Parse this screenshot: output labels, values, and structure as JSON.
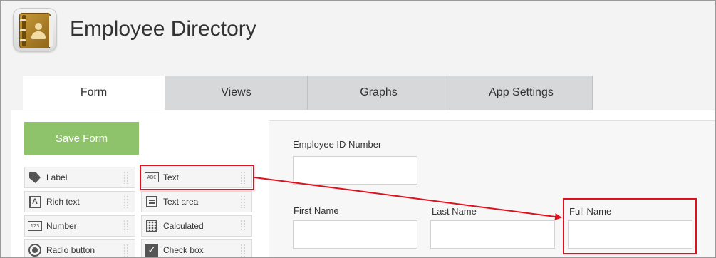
{
  "app": {
    "title": "Employee Directory",
    "icon": "address-book-icon"
  },
  "tabs": [
    {
      "label": "Form",
      "active": true
    },
    {
      "label": "Views",
      "active": false
    },
    {
      "label": "Graphs",
      "active": false
    },
    {
      "label": "App Settings",
      "active": false
    }
  ],
  "toolbar": {
    "save_label": "Save Form"
  },
  "palette": [
    {
      "label": "Label",
      "icon": "tag-icon"
    },
    {
      "label": "Text",
      "icon": "text-field-icon",
      "icon_text": "ABC"
    },
    {
      "label": "Rich text",
      "icon": "rich-text-icon",
      "icon_text": "A"
    },
    {
      "label": "Text area",
      "icon": "text-area-icon"
    },
    {
      "label": "Number",
      "icon": "number-icon",
      "icon_text": "123"
    },
    {
      "label": "Calculated",
      "icon": "calculator-icon"
    },
    {
      "label": "Radio button",
      "icon": "radio-button-icon"
    },
    {
      "label": "Check box",
      "icon": "checkbox-icon",
      "icon_text": "✓"
    }
  ],
  "form_fields": [
    {
      "label": "Employee ID Number"
    },
    {
      "label": "First Name"
    },
    {
      "label": "Last Name"
    },
    {
      "label": "Full Name"
    }
  ],
  "colors": {
    "accent_green": "#8ec26b",
    "annotation_red": "#e0101e",
    "tab_inactive": "#d6d8d9"
  }
}
